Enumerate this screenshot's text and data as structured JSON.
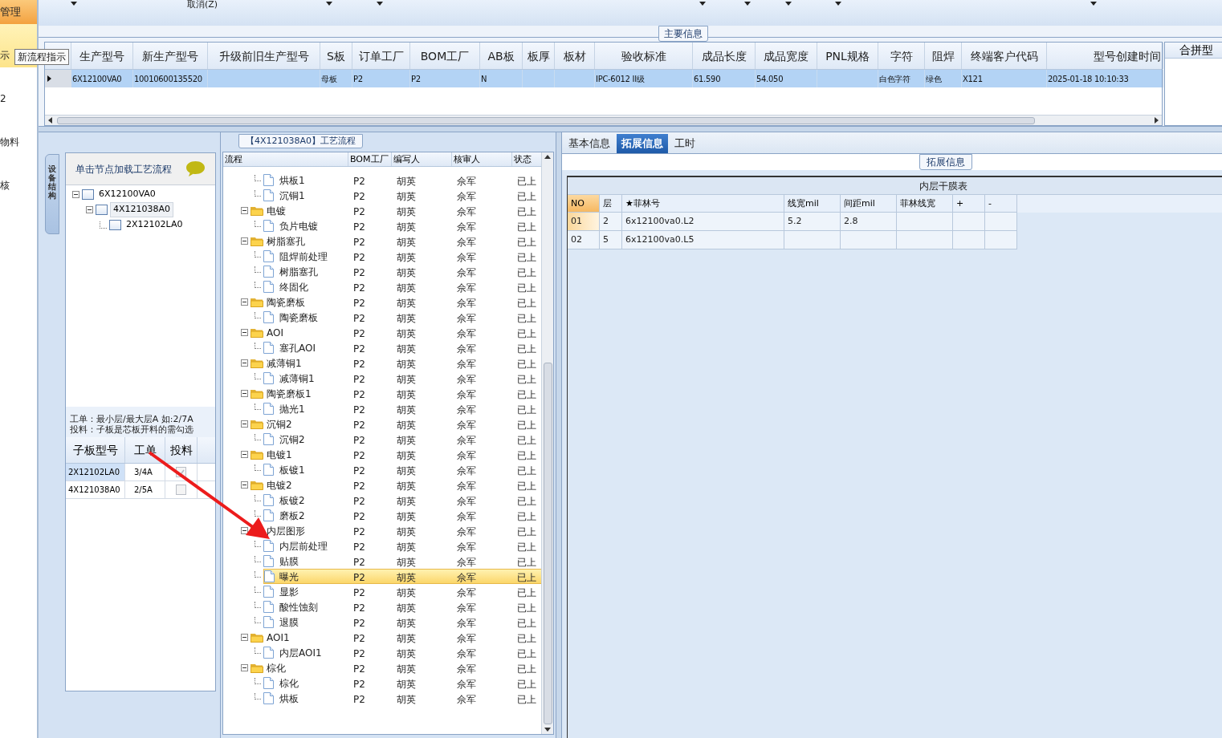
{
  "nav": {
    "group": "管理",
    "items": [
      {
        "label": "示",
        "selected": true
      },
      {
        "label": "2",
        "selected": false
      },
      {
        "label": "物料",
        "selected": false
      },
      {
        "label": "核",
        "selected": false
      }
    ]
  },
  "tooltip": "新流程指示",
  "toolbar": {
    "cancel": "取消(Z)"
  },
  "main_info": {
    "title": "主要信息",
    "columns": [
      "生产型号",
      "新生产型号",
      "升级前旧生产型号",
      "S板",
      "订单工厂",
      "BOM工厂",
      "AB板",
      "板厚",
      "板材",
      "验收标准",
      "成品长度",
      "成品宽度",
      "PNL规格",
      "字符",
      "阻焊",
      "终端客户代码",
      "型号创建时间"
    ],
    "rows": [
      {
        "selected": true,
        "cells": [
          "6X12100VA0",
          "10010600135520",
          null,
          "母板",
          "P2",
          "P2",
          "N",
          null,
          null,
          "IPC-6012 II级",
          "61.590",
          "54.050",
          null,
          "白色字符",
          "绿色",
          "X121",
          "2025-01-18 10:10:33"
        ]
      }
    ],
    "side_column": "合拼型"
  },
  "structure": {
    "tab": "设备结构",
    "title": "单击节点加载工艺流程",
    "nodes": [
      {
        "label": "6X12100VA0",
        "expanded": true,
        "selected": false,
        "children": [
          {
            "label": "4X121038A0",
            "expanded": true,
            "selected": true,
            "children": [
              {
                "label": "2X12102LA0",
                "selected": false
              }
            ]
          }
        ]
      }
    ],
    "note": [
      "工单：最小层/最大层A 如:2/7A",
      "投料：子板是芯板开料的需勾选"
    ],
    "columns": [
      "子板型号",
      "工单",
      "投料"
    ],
    "rows": [
      {
        "model": "2X12102LA0",
        "order": "3/4A",
        "checked": true,
        "selected": true
      },
      {
        "model": "4X121038A0",
        "order": "2/5A",
        "checked": false,
        "selected": false
      }
    ]
  },
  "process_flow": {
    "title": "【4X121038A0】工艺流程",
    "columns": [
      "流程",
      "BOM工厂",
      "编写人",
      "核审人",
      "状态"
    ],
    "rows": [
      {
        "kind": "item",
        "name": "烘板1",
        "factory": "P2",
        "writer": "胡英",
        "reviewer": "佘军",
        "status": "已上",
        "selected": false
      },
      {
        "kind": "item",
        "name": "沉铜1",
        "factory": "P2",
        "writer": "胡英",
        "reviewer": "佘军",
        "status": "已上",
        "selected": false
      },
      {
        "kind": "folder",
        "name": "电镀",
        "factory": "P2",
        "writer": "胡英",
        "reviewer": "佘军",
        "status": "已上",
        "selected": false,
        "expanded": true,
        "children": [
          {
            "kind": "item",
            "name": "负片电镀",
            "factory": "P2",
            "writer": "胡英",
            "reviewer": "佘军",
            "status": "已上",
            "selected": false
          }
        ]
      },
      {
        "kind": "folder",
        "name": "树脂塞孔",
        "factory": "P2",
        "writer": "胡英",
        "reviewer": "佘军",
        "status": "已上",
        "selected": false,
        "expanded": true,
        "children": [
          {
            "kind": "item",
            "name": "阻焊前处理",
            "factory": "P2",
            "writer": "胡英",
            "reviewer": "佘军",
            "status": "已上",
            "selected": false
          },
          {
            "kind": "item",
            "name": "树脂塞孔",
            "factory": "P2",
            "writer": "胡英",
            "reviewer": "佘军",
            "status": "已上",
            "selected": false
          },
          {
            "kind": "item",
            "name": "终固化",
            "factory": "P2",
            "writer": "胡英",
            "reviewer": "佘军",
            "status": "已上",
            "selected": false
          }
        ]
      },
      {
        "kind": "folder",
        "name": "陶瓷磨板",
        "factory": "P2",
        "writer": "胡英",
        "reviewer": "佘军",
        "status": "已上",
        "selected": false,
        "expanded": true,
        "children": [
          {
            "kind": "item",
            "name": "陶瓷磨板",
            "factory": "P2",
            "writer": "胡英",
            "reviewer": "佘军",
            "status": "已上",
            "selected": false
          }
        ]
      },
      {
        "kind": "folder",
        "name": "AOI",
        "factory": "P2",
        "writer": "胡英",
        "reviewer": "佘军",
        "status": "已上",
        "selected": false,
        "expanded": true,
        "children": [
          {
            "kind": "item",
            "name": "塞孔AOI",
            "factory": "P2",
            "writer": "胡英",
            "reviewer": "佘军",
            "status": "已上",
            "selected": false
          }
        ]
      },
      {
        "kind": "folder",
        "name": "减薄铜1",
        "factory": "P2",
        "writer": "胡英",
        "reviewer": "佘军",
        "status": "已上",
        "selected": false,
        "expanded": true,
        "children": [
          {
            "kind": "item",
            "name": "减薄铜1",
            "factory": "P2",
            "writer": "胡英",
            "reviewer": "佘军",
            "status": "已上",
            "selected": false
          }
        ]
      },
      {
        "kind": "folder",
        "name": "陶瓷磨板1",
        "factory": "P2",
        "writer": "胡英",
        "reviewer": "佘军",
        "status": "已上",
        "selected": false,
        "expanded": true,
        "children": [
          {
            "kind": "item",
            "name": "抛光1",
            "factory": "P2",
            "writer": "胡英",
            "reviewer": "佘军",
            "status": "已上",
            "selected": false
          }
        ]
      },
      {
        "kind": "folder",
        "name": "沉铜2",
        "factory": "P2",
        "writer": "胡英",
        "reviewer": "佘军",
        "status": "已上",
        "selected": false,
        "expanded": true,
        "children": [
          {
            "kind": "item",
            "name": "沉铜2",
            "factory": "P2",
            "writer": "胡英",
            "reviewer": "佘军",
            "status": "已上",
            "selected": false
          }
        ]
      },
      {
        "kind": "folder",
        "name": "电镀1",
        "factory": "P2",
        "writer": "胡英",
        "reviewer": "佘军",
        "status": "已上",
        "selected": false,
        "expanded": true,
        "children": [
          {
            "kind": "item",
            "name": "板镀1",
            "factory": "P2",
            "writer": "胡英",
            "reviewer": "佘军",
            "status": "已上",
            "selected": false
          }
        ]
      },
      {
        "kind": "folder",
        "name": "电镀2",
        "factory": "P2",
        "writer": "胡英",
        "reviewer": "佘军",
        "status": "已上",
        "selected": false,
        "expanded": true,
        "children": [
          {
            "kind": "item",
            "name": "板镀2",
            "factory": "P2",
            "writer": "胡英",
            "reviewer": "佘军",
            "status": "已上",
            "selected": false
          },
          {
            "kind": "item",
            "name": "磨板2",
            "factory": "P2",
            "writer": "胡英",
            "reviewer": "佘军",
            "status": "已上",
            "selected": false
          }
        ]
      },
      {
        "kind": "folder",
        "name": "内层图形",
        "factory": "P2",
        "writer": "胡英",
        "reviewer": "佘军",
        "status": "已上",
        "selected": false,
        "expanded": true,
        "children": [
          {
            "kind": "item",
            "name": "内层前处理",
            "factory": "P2",
            "writer": "胡英",
            "reviewer": "佘军",
            "status": "已上",
            "selected": false
          },
          {
            "kind": "item",
            "name": "贴膜",
            "factory": "P2",
            "writer": "胡英",
            "reviewer": "佘军",
            "status": "已上",
            "selected": false
          },
          {
            "kind": "item",
            "name": "曝光",
            "factory": "P2",
            "writer": "胡英",
            "reviewer": "佘军",
            "status": "已上",
            "selected": true
          },
          {
            "kind": "item",
            "name": "显影",
            "factory": "P2",
            "writer": "胡英",
            "reviewer": "佘军",
            "status": "已上",
            "selected": false
          },
          {
            "kind": "item",
            "name": "酸性蚀刻",
            "factory": "P2",
            "writer": "胡英",
            "reviewer": "佘军",
            "status": "已上",
            "selected": false
          },
          {
            "kind": "item",
            "name": "退膜",
            "factory": "P2",
            "writer": "胡英",
            "reviewer": "佘军",
            "status": "已上",
            "selected": false
          }
        ]
      },
      {
        "kind": "folder",
        "name": "AOI1",
        "factory": "P2",
        "writer": "胡英",
        "reviewer": "佘军",
        "status": "已上",
        "selected": false,
        "expanded": true,
        "children": [
          {
            "kind": "item",
            "name": "内层AOI1",
            "factory": "P2",
            "writer": "胡英",
            "reviewer": "佘军",
            "status": "已上",
            "selected": false
          }
        ]
      },
      {
        "kind": "folder",
        "name": "棕化",
        "factory": "P2",
        "writer": "胡英",
        "reviewer": "佘军",
        "status": "已上",
        "selected": false,
        "expanded": true,
        "children": [
          {
            "kind": "item",
            "name": "棕化",
            "factory": "P2",
            "writer": "胡英",
            "reviewer": "佘军",
            "status": "已上",
            "selected": false
          },
          {
            "kind": "item",
            "name": "烘板",
            "factory": "P2",
            "writer": "胡英",
            "reviewer": "佘军",
            "status": "已上",
            "selected": false
          }
        ]
      }
    ]
  },
  "detail_tabs": [
    {
      "label": "基本信息",
      "selected": false
    },
    {
      "label": "拓展信息",
      "selected": true
    },
    {
      "label": "工时",
      "selected": false
    }
  ],
  "extended": {
    "title": "拓展信息",
    "table_title": "内层干膜表",
    "columns": [
      "NO",
      "层",
      "★菲林号",
      "线宽mil",
      "间距mil",
      "菲林线宽",
      "+",
      "-"
    ],
    "rows": [
      {
        "selected": true,
        "cells": [
          "01",
          "2",
          "6x12100va0.L2",
          "5.2",
          "2.8",
          null,
          null,
          null
        ]
      },
      {
        "selected": false,
        "cells": [
          "02",
          "5",
          "6x12100va0.L5",
          null,
          null,
          null,
          null,
          null
        ]
      }
    ]
  }
}
